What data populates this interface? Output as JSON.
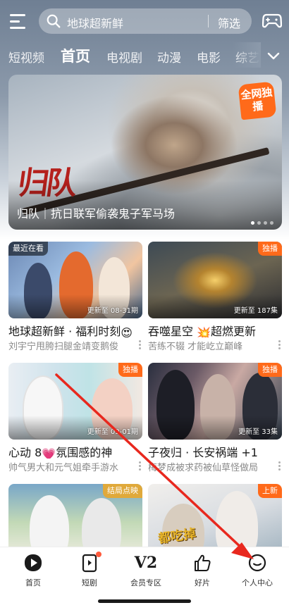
{
  "header": {
    "search_placeholder": "地球超新鲜",
    "filter_label": "筛选"
  },
  "nav": {
    "tabs": [
      "短视频",
      "首页",
      "电视剧",
      "动漫",
      "电影",
      "综艺"
    ],
    "active_index": 1
  },
  "banner": {
    "logo_text": "归队",
    "badge_text": "全网独播",
    "caption": "归队｜抗日联军偷袭鬼子军马场",
    "dots_total": 4,
    "dots_active": 0
  },
  "cards": [
    {
      "tag_left": "最近在看",
      "tag_right": "",
      "episode": "更新至 08-31期",
      "title": "地球超新鲜 · 福利时刻",
      "emoji": "😍",
      "subtitle": "刘宇宁甩胯扫腿金靖变鹅俊"
    },
    {
      "tag_left": "",
      "tag_right": "独播",
      "episode": "更新至 187集",
      "title": "吞噬星空",
      "emoji": "💥",
      "title_suffix": "超燃更新",
      "subtitle": "苦练不辍 才能屹立巅峰"
    },
    {
      "tag_left": "",
      "tag_right": "独播",
      "episode": "更新至 09-01期",
      "title": "心动 8",
      "emoji": "💗",
      "title_suffix": "氛围感的神",
      "subtitle": "帅气男大和元气姐牵手游水"
    },
    {
      "tag_left": "",
      "tag_right": "独播",
      "episode": "更新至 33集",
      "title": "子夜归 · 长安祸端 +1",
      "emoji": "",
      "subtitle": "梅梦成被求药被仙草怪做局"
    },
    {
      "tag_left": "",
      "tag_right": "结局点映",
      "episode": "",
      "title": "",
      "emoji": "",
      "subtitle": ""
    },
    {
      "tag_left": "",
      "tag_right": "上新",
      "episode": "",
      "title": "",
      "emoji": "",
      "subtitle": "",
      "inner_text": "都吃掉"
    }
  ],
  "tabbar": {
    "items": [
      {
        "label": "首页",
        "icon": "play-logo-icon"
      },
      {
        "label": "短剧",
        "icon": "phone-play-icon",
        "badge": true
      },
      {
        "label": "会员专区",
        "icon": "v2-vip-icon",
        "icon_text": "V2"
      },
      {
        "label": "好片",
        "icon": "thumbs-up-icon"
      },
      {
        "label": "个人中心",
        "icon": "smile-face-icon"
      }
    ]
  },
  "colors": {
    "accent_orange": "#ff6a1a",
    "arrow_red": "#e8281e",
    "badge_gold": "#e0a93b"
  }
}
